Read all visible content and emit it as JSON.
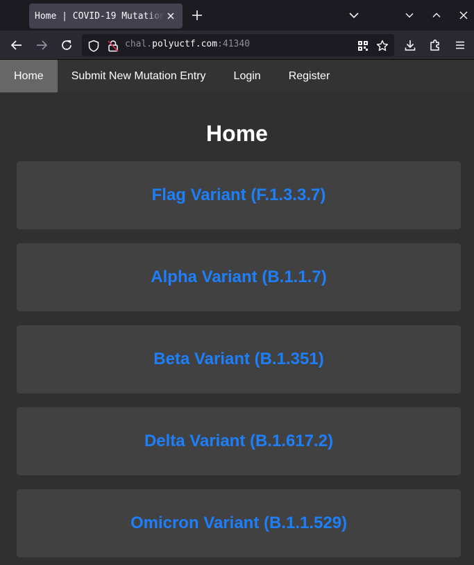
{
  "browser": {
    "tab": {
      "title": "Home | COVID-19 Mutation"
    },
    "url": {
      "scheme_sub": "chal.",
      "domain": "polyuctf.com",
      "port": ":41340"
    },
    "colors": {
      "chrome_bg": "#1c1b22",
      "toolbar_bg": "#2b2a33",
      "tab_active": "#42414d"
    }
  },
  "site": {
    "nav": [
      {
        "label": "Home",
        "active": true
      },
      {
        "label": "Submit New Mutation Entry",
        "active": false
      },
      {
        "label": "Login",
        "active": false
      },
      {
        "label": "Register",
        "active": false
      }
    ],
    "page_title": "Home",
    "variants": [
      {
        "label": "Flag Variant (F.1.3.3.7)"
      },
      {
        "label": "Alpha Variant (B.1.1.7)"
      },
      {
        "label": "Beta Variant (B.1.351)"
      },
      {
        "label": "Delta Variant (B.1.617.2)"
      },
      {
        "label": "Omicron Variant (B.1.1.529)"
      }
    ],
    "colors": {
      "page_bg": "#303030",
      "nav_bg": "#333333",
      "nav_active": "#676767",
      "card_bg": "#414141",
      "link": "#1e7ffa"
    }
  }
}
